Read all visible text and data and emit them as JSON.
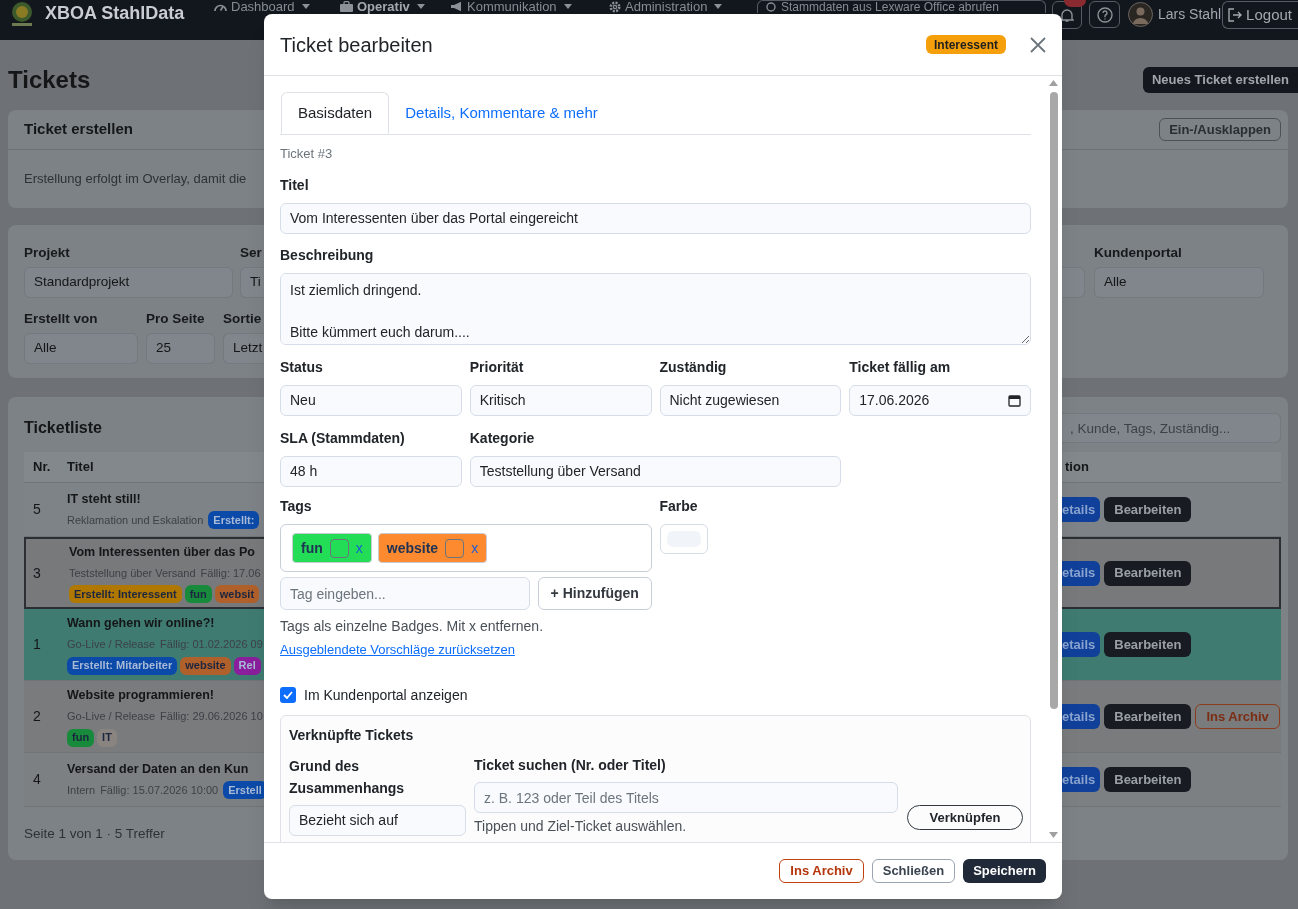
{
  "navbar": {
    "brand": "XBOA StahlData",
    "menus": [
      {
        "label": "Dashboard",
        "selected": false
      },
      {
        "label": "Operativ",
        "selected": true
      },
      {
        "label": "Kommunikation",
        "selected": false
      },
      {
        "label": "Administration",
        "selected": false
      }
    ],
    "sync_button": "Stammdaten aus Lexware Office abrufen",
    "user": "Lars Stahl",
    "logout": "Logout"
  },
  "page": {
    "title": "Tickets",
    "new_ticket_button": "Neues Ticket erstellen",
    "create_card": {
      "title": "Ticket erstellen",
      "toggle_button": "Ein-/Ausklappen",
      "text": "Erstellung erfolgt im Overlay, damit die"
    },
    "filters": {
      "first_row": [
        {
          "label": "Projekt",
          "value": "Standardprojekt"
        },
        {
          "label": "Ser",
          "value": "Ti"
        }
      ],
      "first_row_right": [
        {
          "label": "Kundenportal",
          "value": "Alle"
        }
      ],
      "second_row": [
        {
          "label": "Erstellt von",
          "value": "Alle"
        },
        {
          "label": "Pro Seite",
          "value": "25"
        },
        {
          "label": "Sortie",
          "value": "Letzt"
        }
      ]
    },
    "ticket_list": {
      "title": "Ticketliste",
      "search_placeholder": ", Kunde, Tags, Zuständig...",
      "columns": [
        "Nr.",
        "Titel",
        "tion"
      ],
      "rows": [
        {
          "nr": "5",
          "title": "IT steht still!",
          "category": "Reklamation und Eskalation",
          "kind": "compact",
          "selected": false,
          "color": "#7e8387",
          "badges": [
            {
              "label": "Erstellt:",
              "color": "#0b4aa8"
            }
          ],
          "actions": [
            {
              "label": "etails",
              "kind": "details"
            },
            {
              "label": "Bearbeiten",
              "kind": "edit"
            }
          ]
        },
        {
          "nr": "3",
          "title": "Vom Interessenten über das Po",
          "category": "Teststellung über Versand",
          "due": "Fällig: 17.06",
          "kind": "full",
          "selected": true,
          "color": "#77797b",
          "badges": [
            {
              "label": "Erstellt: Interessent",
              "color": "#b07800"
            },
            {
              "label": "fun",
              "color": "#178a3c"
            },
            {
              "label": "websit",
              "color": "#b0602a"
            }
          ],
          "actions": [
            {
              "label": "etails",
              "kind": "details"
            },
            {
              "label": "Bearbeiten",
              "kind": "edit"
            }
          ]
        },
        {
          "nr": "1",
          "title": "Wann gehen wir online?!",
          "category": "Go-Live / Release",
          "due": "Fällig: 01.02.2026 09",
          "kind": "full",
          "selected": false,
          "color": "#3f7b71",
          "badges": [
            {
              "label": "Erstellt: Mitarbeiter",
              "color": "#0b4aa8"
            },
            {
              "label": "website",
              "color": "#b0602a"
            },
            {
              "label": "Rel",
              "color": "#8a1e9c"
            }
          ],
          "actions": [
            {
              "label": "etails",
              "kind": "details"
            },
            {
              "label": "Bearbeiten",
              "kind": "edit"
            }
          ]
        },
        {
          "nr": "2",
          "title": "Website programmieren!",
          "category": "Go-Live / Release",
          "due": "Fällig: 29.06.2026 10",
          "kind": "full",
          "selected": false,
          "color": "#7a7b7c",
          "badges": [
            {
              "label": "fun",
              "color": "#178a3c"
            },
            {
              "label": "IT",
              "color": "#8a8480"
            }
          ],
          "actions": [
            {
              "label": "etails",
              "kind": "details"
            },
            {
              "label": "Bearbeiten",
              "kind": "edit"
            },
            {
              "label": "Ins Archiv",
              "kind": "archive"
            }
          ]
        },
        {
          "nr": "4",
          "title": "Versand der Daten an den Kun",
          "category": "Intern",
          "due": "Fällig: 15.07.2026 10:00",
          "kind": "compact",
          "selected": false,
          "color": "#7d8083",
          "badges": [
            {
              "label": "Erstell",
              "color": "#0b4aa8"
            }
          ],
          "actions": [
            {
              "label": "etails",
              "kind": "details"
            },
            {
              "label": "Bearbeiten",
              "kind": "edit"
            }
          ]
        }
      ],
      "footer": "Seite 1 von 1 · 5 Treffer"
    }
  },
  "modal": {
    "title": "Ticket bearbeiten",
    "origin_badge": "Interessent",
    "tabs": [
      {
        "label": "Basisdaten",
        "selected": true
      },
      {
        "label": "Details, Kommentare & mehr",
        "selected": false
      }
    ],
    "ticket_number": "Ticket #3",
    "title_field": {
      "label": "Titel",
      "value": "Vom Interessenten über das Portal eingereicht"
    },
    "description": {
      "label": "Beschreibung",
      "value": "Ist ziemlich dringend.\n\nBitte kümmert euch darum...."
    },
    "fields": [
      {
        "label": "Status",
        "value": "Neu",
        "kind": "text"
      },
      {
        "label": "Priorität",
        "value": "Kritisch",
        "kind": "text"
      },
      {
        "label": "Zuständig",
        "value": "Nicht zugewiesen",
        "kind": "text"
      },
      {
        "label": "Ticket fällig am",
        "value": "17.06.2026",
        "kind": "date"
      },
      {
        "label": "SLA (Stammdaten)",
        "value": "48 h",
        "kind": "text"
      },
      {
        "label": "Kategorie",
        "value": "Teststellung über Versand",
        "kind": "wide"
      }
    ],
    "tags": {
      "label": "Tags",
      "items": [
        {
          "label": "fun",
          "color": "#22dd55",
          "remove": "x"
        },
        {
          "label": "website",
          "color": "#fd8a2e",
          "remove": "x"
        }
      ],
      "input_placeholder": "Tag eingeben...",
      "add_button": "+ Hinzufügen",
      "help": "Tags als einzelne Badges. Mit x entfernen.",
      "reset_link": "Ausgeblendete Vorschläge zurücksetzen"
    },
    "color_field": {
      "label": "Farbe"
    },
    "portal_checkbox": {
      "label": "Im Kundenportal anzeigen",
      "checked": true
    },
    "linked": {
      "title": "Verknüpfte Tickets",
      "reason_label": "Grund des Zusammenhangs",
      "reason_value": "Bezieht sich auf",
      "search_label": "Ticket suchen (Nr. oder Titel)",
      "search_placeholder": "z. B. 123 oder Teil des Titels",
      "help": "Tippen und Ziel-Ticket auswählen.",
      "link_button": "Verknüpfen"
    },
    "footer_buttons": [
      {
        "label": "Ins Archiv",
        "kind": "archive"
      },
      {
        "label": "Schließen",
        "kind": "secondary"
      },
      {
        "label": "Speichern",
        "kind": "primary"
      }
    ]
  }
}
